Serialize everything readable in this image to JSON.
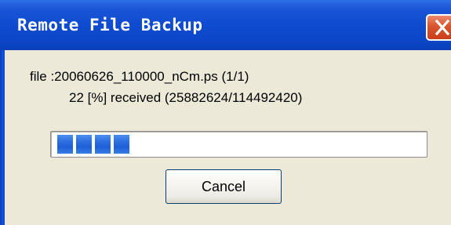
{
  "window": {
    "title": "Remote File Backup",
    "close_icon": "close-icon"
  },
  "transfer": {
    "file_line": "file :20060626_110000_nCm.ps (1/1)",
    "received_line": "22 [%] received (25882624/114492420)",
    "progress_percent": 22
  },
  "actions": {
    "cancel_label": "Cancel"
  },
  "colors": {
    "titlebar": "#0f4bd0",
    "client_bg": "#ece9d8",
    "progress_fill": "#2e6fe0",
    "close_button": "#d9542e"
  }
}
